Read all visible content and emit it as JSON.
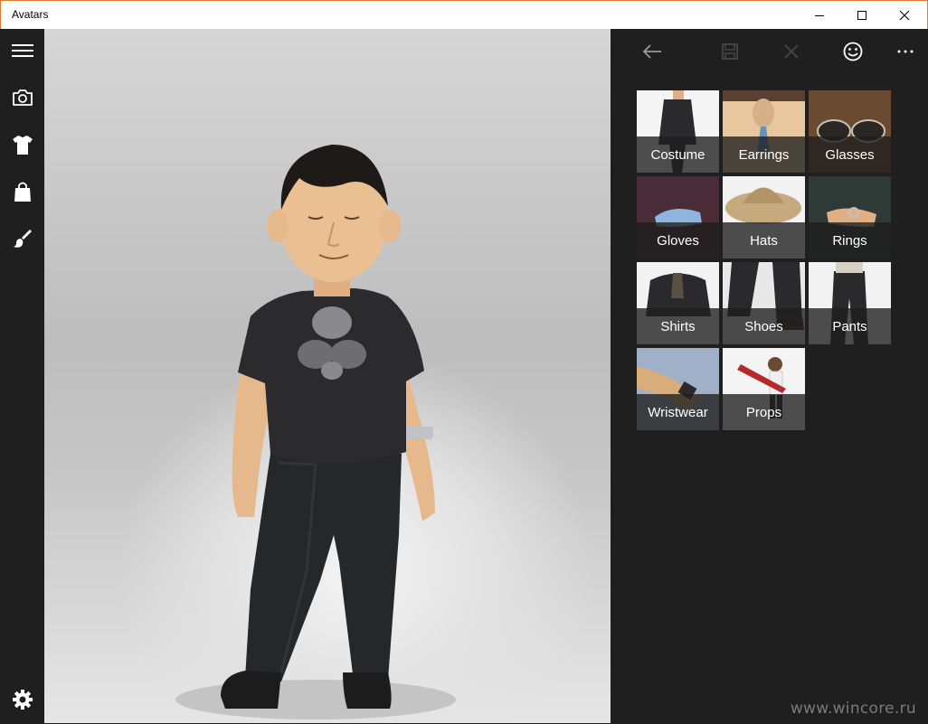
{
  "window": {
    "title": "Avatars",
    "controls": [
      "minimize-icon",
      "maximize-icon",
      "close-icon"
    ]
  },
  "nav_rail": {
    "items": [
      {
        "name": "menu",
        "icon": "hamburger-menu-icon"
      },
      {
        "name": "camera",
        "icon": "camera-icon"
      },
      {
        "name": "clothing",
        "icon": "tshirt-icon"
      },
      {
        "name": "store",
        "icon": "shopping-bag-icon"
      },
      {
        "name": "style",
        "icon": "paintbrush-icon"
      }
    ],
    "settings_icon": "gear-icon"
  },
  "command_bar": {
    "buttons": [
      {
        "name": "back",
        "icon": "back-arrow-icon",
        "enabled": true
      },
      {
        "name": "save",
        "icon": "save-icon",
        "enabled": false
      },
      {
        "name": "cancel",
        "icon": "close-icon",
        "enabled": false
      },
      {
        "name": "emote",
        "icon": "smiley-icon",
        "enabled": true
      },
      {
        "name": "more",
        "icon": "more-icon",
        "enabled": true
      }
    ]
  },
  "categories": [
    {
      "label": "Costume"
    },
    {
      "label": "Earrings"
    },
    {
      "label": "Glasses"
    },
    {
      "label": "Gloves"
    },
    {
      "label": "Hats"
    },
    {
      "label": "Rings"
    },
    {
      "label": "Shirts"
    },
    {
      "label": "Shoes"
    },
    {
      "label": "Pants"
    },
    {
      "label": "Wristwear"
    },
    {
      "label": "Props"
    }
  ],
  "watermark": "www.wincore.ru",
  "colors": {
    "panel_bg": "#1f1f1f",
    "window_accent": "#e8772e",
    "tile_label_bg": "#1e1e1e"
  }
}
